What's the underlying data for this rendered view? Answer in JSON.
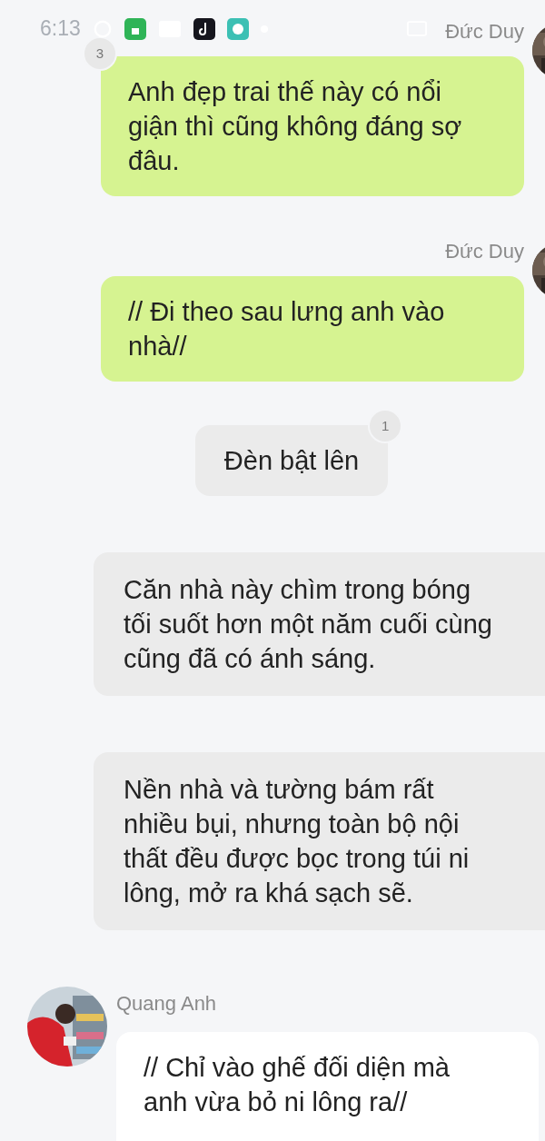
{
  "status_bar": {
    "time": "6:13"
  },
  "messages": [
    {
      "kind": "own",
      "sender": "Đức Duy",
      "badge": "3",
      "text": "Anh đẹp trai thế này có nổi giận thì cũng không đáng sợ đâu."
    },
    {
      "kind": "own",
      "sender": "Đức Duy",
      "text": "// Đi theo sau lưng anh vào nhà//"
    },
    {
      "kind": "note",
      "badge": "1",
      "text": "Đèn bật lên"
    },
    {
      "kind": "narration",
      "text": "Căn nhà này chìm trong bóng tối suốt hơn một năm cuối cùng cũng đã có ánh sáng."
    },
    {
      "kind": "narration",
      "text": "Nền nhà và tường bám rất nhiều bụi, nhưng toàn bộ nội thất đều được bọc trong túi ni lông, mở ra khá sạch sẽ."
    },
    {
      "kind": "other",
      "sender": "Quang Anh",
      "text": "// Chỉ vào ghế đối diện mà anh vừa bỏ ni lông ra//"
    }
  ]
}
